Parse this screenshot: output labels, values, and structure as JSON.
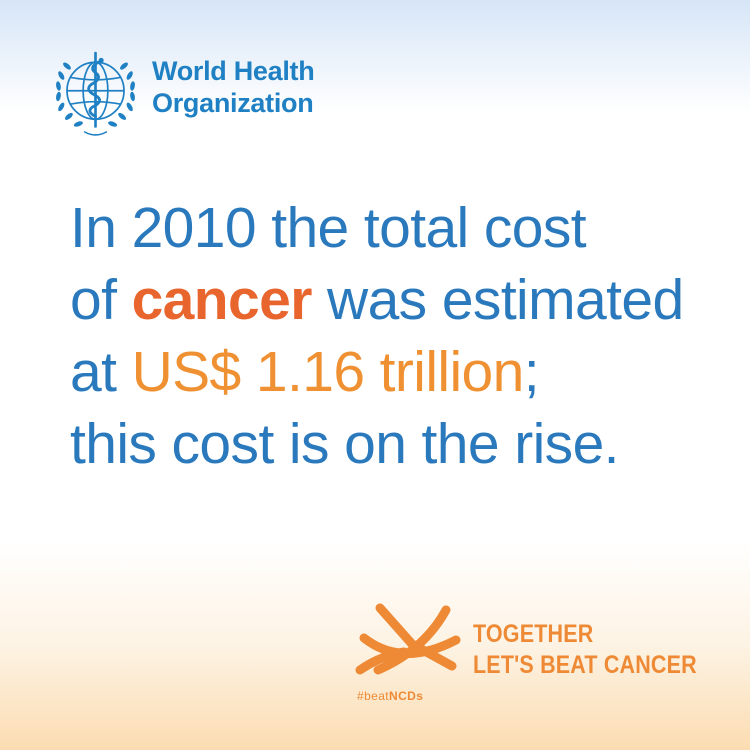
{
  "organization": {
    "name_line1": "World Health",
    "name_line2": "Organization"
  },
  "headline": {
    "line1": "In 2010 the total cost",
    "line2_prefix": "of ",
    "line2_highlight": "cancer",
    "line2_suffix": " was estimated",
    "line3_prefix": "at ",
    "line3_highlight": "US$ 1.16 trillion",
    "line3_suffix": ";",
    "line4": "this cost is on the rise."
  },
  "campaign": {
    "hashtag_prefix": "#beat",
    "hashtag_bold": "NCDs",
    "tagline_line1": "TOGETHER",
    "tagline_line2": "LET'S BEAT CANCER"
  },
  "colors": {
    "who_blue": "#1f80c4",
    "headline_blue": "#2a79bd",
    "cancer_orange": "#e8662d",
    "amount_orange": "#ef9032",
    "campaign_orange": "#ee8a35"
  },
  "icons": {
    "logo": "who-emblem-icon",
    "campaign": "beat-ncds-ribbon-icon"
  }
}
